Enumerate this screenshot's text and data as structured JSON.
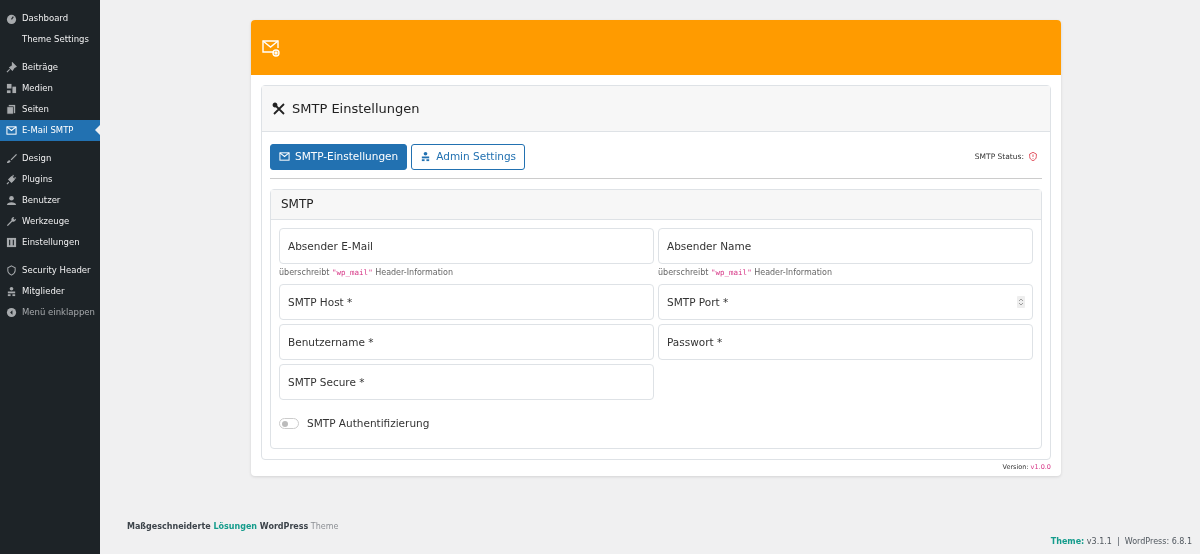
{
  "sidebar": {
    "groups": [
      [
        {
          "label": "Dashboard",
          "selected": false,
          "children": [
            {
              "label": "Theme Settings",
              "selected": false
            }
          ]
        }
      ],
      [
        {
          "label": "Beiträge",
          "selected": false
        },
        {
          "label": "Medien",
          "selected": false
        },
        {
          "label": "Seiten",
          "selected": false
        },
        {
          "label": "E-Mail SMTP",
          "selected": true
        }
      ],
      [
        {
          "label": "Design",
          "selected": false
        },
        {
          "label": "Plugins",
          "selected": false
        },
        {
          "label": "Benutzer",
          "selected": false
        },
        {
          "label": "Werkzeuge",
          "selected": false
        },
        {
          "label": "Einstellungen",
          "selected": false
        }
      ],
      [
        {
          "label": "Security Header",
          "selected": false
        },
        {
          "label": "Mitglieder",
          "selected": false
        },
        {
          "label": "Menü einklappen",
          "selected": false,
          "disabled": true
        }
      ]
    ]
  },
  "settings_card": {
    "title": "SMTP Einstellungen",
    "tabs": [
      {
        "label": "SMTP-Einstellungen",
        "selected": true
      },
      {
        "label": "Admin Settings",
        "selected": false
      }
    ],
    "status": {
      "label": "SMTP Status:",
      "ok": false
    },
    "section": {
      "title": "SMTP",
      "fields": [
        {
          "placeholder": "Absender E-Mail",
          "kind": "text",
          "hint": [
            {
              "text": "überschreibt ",
              "kind": "plain"
            },
            {
              "text": "\"wp_mail\"",
              "kind": "code"
            },
            {
              "text": " Header-Information",
              "kind": "plain"
            }
          ]
        },
        {
          "placeholder": "Absender Name",
          "kind": "text",
          "hint": [
            {
              "text": "überschreibt ",
              "kind": "plain"
            },
            {
              "text": "\"wp_mail\"",
              "kind": "code"
            },
            {
              "text": " Header-Information",
              "kind": "plain"
            }
          ]
        },
        {
          "placeholder": "SMTP Host *",
          "kind": "text"
        },
        {
          "placeholder": "SMTP Port *",
          "kind": "number"
        },
        {
          "placeholder": "Benutzername *",
          "kind": "text"
        },
        {
          "placeholder": "Passwort *",
          "kind": "password"
        },
        {
          "placeholder": "SMTP Secure *",
          "kind": "text"
        }
      ],
      "toggle": {
        "label": "SMTP Authentifizierung",
        "checked": false
      }
    },
    "version": [
      {
        "text": "Version: ",
        "kind": "plain"
      },
      {
        "text": "v1.0.0",
        "kind": "accent"
      }
    ]
  },
  "footer": {
    "left": [
      {
        "text": "Maßgeschneiderte ",
        "kind": "bold"
      },
      {
        "text": "Lösungen",
        "kind": "accent"
      },
      {
        "text": " WordPress",
        "kind": "bold"
      },
      {
        "text": " Theme",
        "kind": "muted"
      }
    ],
    "right": [
      {
        "text": "Theme:",
        "kind": "accent"
      },
      {
        "text": " v3.1.1  |  WordPress: 6.8.1",
        "kind": "plain"
      }
    ]
  }
}
